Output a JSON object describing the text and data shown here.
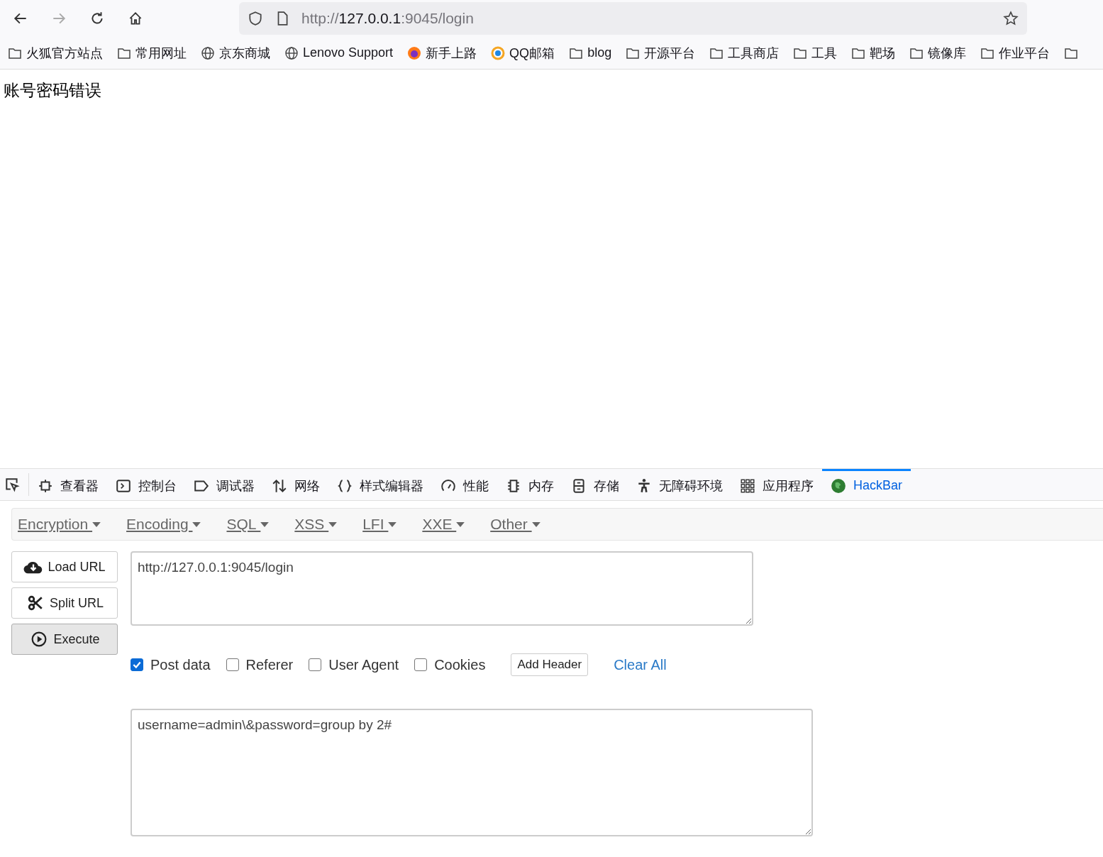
{
  "address": {
    "prefix": "http://",
    "host": "127.0.0.1",
    "suffix": ":9045/login"
  },
  "bookmarks": [
    {
      "kind": "folder",
      "label": "火狐官方站点"
    },
    {
      "kind": "folder",
      "label": "常用网址"
    },
    {
      "kind": "globe",
      "label": "京东商城"
    },
    {
      "kind": "globe",
      "label": "Lenovo Support"
    },
    {
      "kind": "firefox",
      "label": "新手上路"
    },
    {
      "kind": "qq",
      "label": "QQ邮箱"
    },
    {
      "kind": "folder",
      "label": "blog"
    },
    {
      "kind": "folder",
      "label": "开源平台"
    },
    {
      "kind": "folder",
      "label": "工具商店"
    },
    {
      "kind": "folder",
      "label": "工具"
    },
    {
      "kind": "folder",
      "label": "靶场"
    },
    {
      "kind": "folder",
      "label": "镜像库"
    },
    {
      "kind": "folder",
      "label": "作业平台"
    }
  ],
  "page_message": "账号密码错误",
  "devtools_tabs": [
    {
      "kind": "inspector",
      "label": "查看器",
      "selected": false
    },
    {
      "kind": "console",
      "label": "控制台",
      "selected": false
    },
    {
      "kind": "debugger",
      "label": "调试器",
      "selected": false
    },
    {
      "kind": "network",
      "label": "网络",
      "selected": false
    },
    {
      "kind": "style",
      "label": "样式编辑器",
      "selected": false
    },
    {
      "kind": "performance",
      "label": "性能",
      "selected": false
    },
    {
      "kind": "memory",
      "label": "内存",
      "selected": false
    },
    {
      "kind": "storage",
      "label": "存储",
      "selected": false
    },
    {
      "kind": "accessibility",
      "label": "无障碍环境",
      "selected": false
    },
    {
      "kind": "apps",
      "label": "应用程序",
      "selected": false
    },
    {
      "kind": "hackbar",
      "label": "HackBar",
      "selected": true
    }
  ],
  "hackbar_menus": [
    "Encryption",
    "Encoding",
    "SQL",
    "XSS",
    "LFI",
    "XXE",
    "Other"
  ],
  "actions": [
    {
      "kind": "load",
      "label": "Load URL"
    },
    {
      "kind": "split",
      "label": "Split URL"
    },
    {
      "kind": "execute",
      "label": "Execute"
    }
  ],
  "url_value": "http://127.0.0.1:9045/login",
  "options": [
    {
      "label": "Post data",
      "checked": true
    },
    {
      "label": "Referer",
      "checked": false
    },
    {
      "label": "User Agent",
      "checked": false
    },
    {
      "label": "Cookies",
      "checked": false
    }
  ],
  "add_header": "Add Header",
  "clear_all": "Clear All",
  "post_value": "username=admin\\&password=group by 2#"
}
